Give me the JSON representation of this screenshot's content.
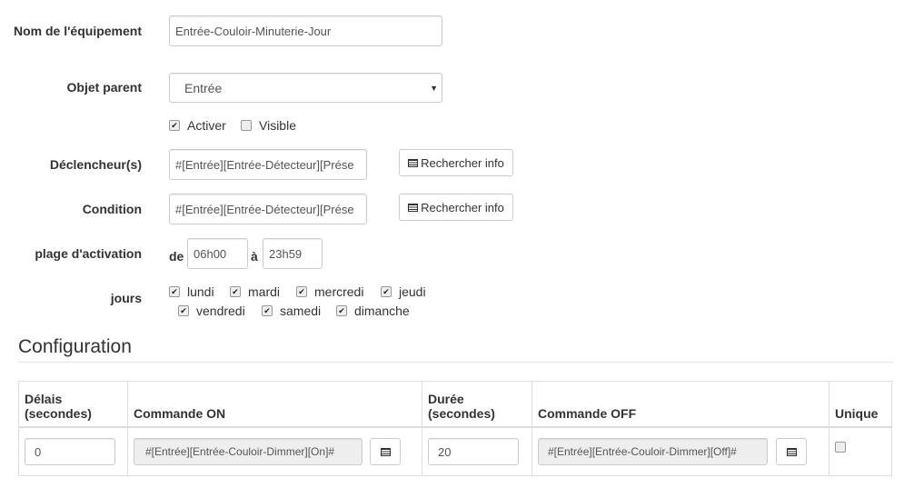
{
  "form": {
    "name_label": "Nom de l'équipement",
    "name_value": "Entrée-Couloir-Minuterie-Jour",
    "parent_label": "Objet parent",
    "parent_value": "Entrée",
    "activer_label": "Activer",
    "activer_checked": true,
    "visible_label": "Visible",
    "visible_checked": false,
    "trigger_label": "Déclencheur(s)",
    "trigger_value": "#[Entrée][Entrée-Détecteur][Prése",
    "condition_label": "Condition",
    "condition_value": "#[Entrée][Entrée-Détecteur][Prése",
    "search_button": "Rechercher info",
    "range_label": "plage d'activation",
    "from_label": "de",
    "from_value": "06h00",
    "to_label": "à",
    "to_value": "23h59",
    "days_label": "jours",
    "days": [
      {
        "label": "lundi",
        "checked": true
      },
      {
        "label": "mardi",
        "checked": true
      },
      {
        "label": "mercredi",
        "checked": true
      },
      {
        "label": "jeudi",
        "checked": true
      },
      {
        "label": "vendredi",
        "checked": true
      },
      {
        "label": "samedi",
        "checked": true
      },
      {
        "label": "dimanche",
        "checked": true
      }
    ]
  },
  "config": {
    "title": "Configuration",
    "headers": [
      "Délais (secondes)",
      "Commande ON",
      "Durée (secondes)",
      "Commande OFF",
      "Unique"
    ],
    "row": {
      "delay": "0",
      "cmd_on": "#[Entrée][Entrée-Couloir-Dimmer][On]#",
      "duration": "20",
      "cmd_off": "#[Entrée][Entrée-Couloir-Dimmer][Off]#",
      "unique": false
    }
  }
}
